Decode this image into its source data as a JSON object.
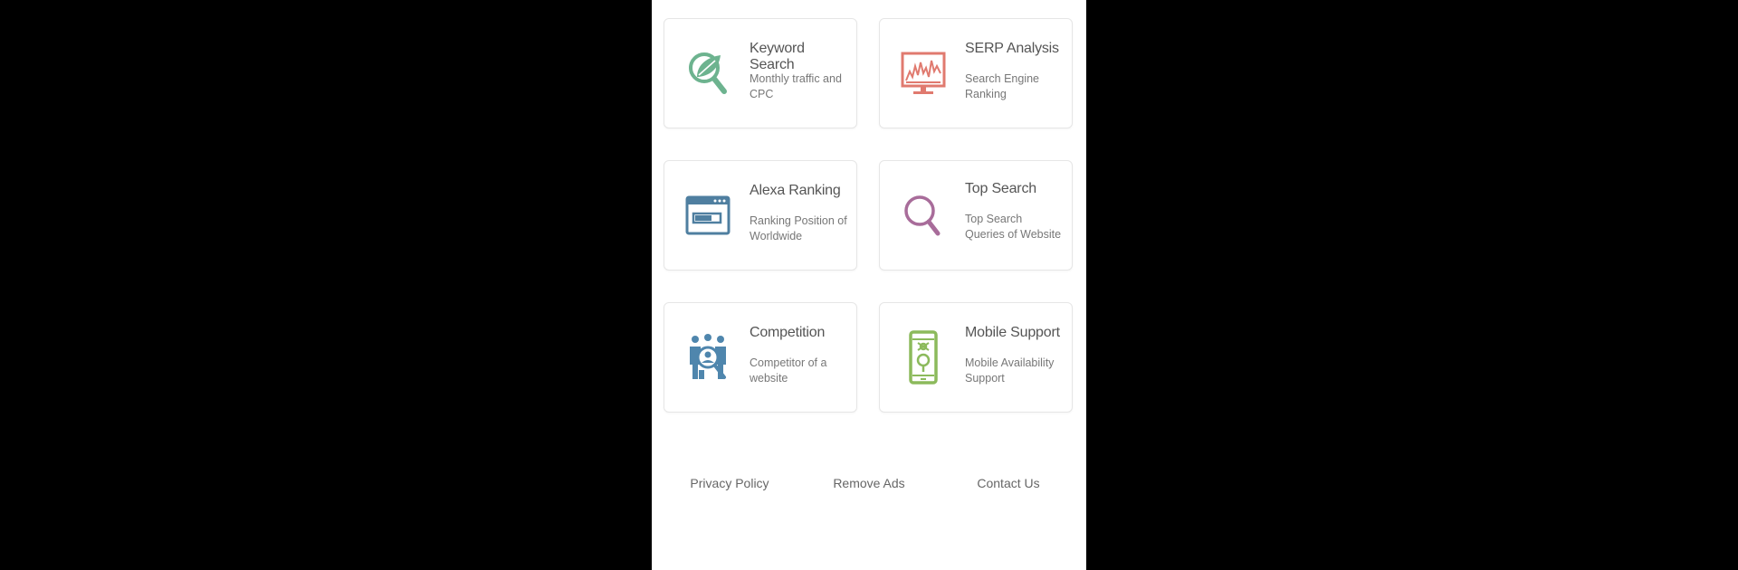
{
  "cards": [
    {
      "title": "Keyword Search",
      "desc": "Monthly traffic and CPC",
      "icon": "leaf-magnifier-icon",
      "color": "#6db38f"
    },
    {
      "title": "SERP Analysis",
      "desc": "Search Engine Ranking",
      "icon": "monitor-chart-icon",
      "color": "#e07a6f"
    },
    {
      "title": "Alexa Ranking",
      "desc": "Ranking Position of Worldwide",
      "icon": "browser-window-icon",
      "color": "#4f7fa0"
    },
    {
      "title": "Top Search",
      "desc": "Top Search Queries of Website",
      "icon": "magnifier-icon",
      "color": "#a86c9a"
    },
    {
      "title": "Competition",
      "desc": "Competitor of a website",
      "icon": "people-magnifier-icon",
      "color": "#4f86ad"
    },
    {
      "title": "Mobile Support",
      "desc": "Mobile Availability Support",
      "icon": "mobile-gear-icon",
      "color": "#8cba5c"
    }
  ],
  "footer": {
    "privacy": "Privacy Policy",
    "remove_ads": "Remove Ads",
    "contact": "Contact Us"
  }
}
